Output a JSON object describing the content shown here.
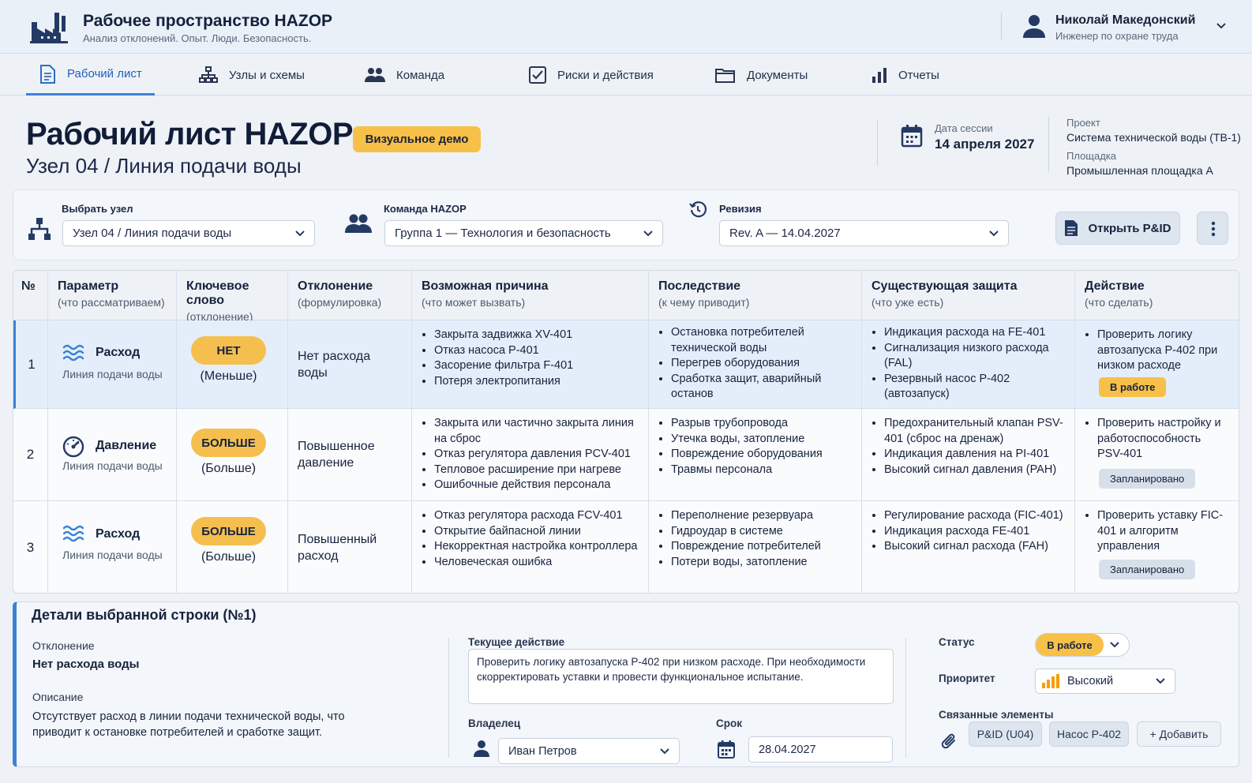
{
  "header": {
    "title": "Рабочее пространство HAZOP",
    "subtitle": "Анализ отклонений. Опыт. Люди. Безопасность.",
    "user_name": "Николай Македонский",
    "user_role": "Инженер по охране труда"
  },
  "nav": {
    "tabs": [
      {
        "label": "Рабочий лист",
        "icon": "document-icon",
        "active": true
      },
      {
        "label": "Узлы и схемы",
        "icon": "hierarchy-icon"
      },
      {
        "label": "Команда",
        "icon": "team-icon"
      },
      {
        "label": "Риски и действия",
        "icon": "checkbox-icon"
      },
      {
        "label": "Документы",
        "icon": "folder-icon"
      },
      {
        "label": "Отчеты",
        "icon": "bar-chart-icon"
      }
    ]
  },
  "page": {
    "title": "Рабочий лист HAZOP",
    "badge": "Визуальное демо",
    "subtitle": "Узел 04 / Линия подачи воды",
    "date_label": "Дата сессии",
    "date_value": "14 апреля 2027",
    "project_label": "Проект",
    "project_value": "Система технической воды (ТВ-1)",
    "site_label": "Площадка",
    "site_value": "Промышленная площадка А"
  },
  "filters": {
    "node_label": "Выбрать узел",
    "node_value": "Узел 04 / Линия подачи воды",
    "team_label": "Команда HAZOP",
    "team_value": "Группа 1 — Технология и безопасность",
    "rev_label": "Ревизия",
    "rev_value": "Rev. A — 14.04.2027",
    "pid_button": "Открыть P&ID"
  },
  "table": {
    "columns": [
      {
        "title": "№",
        "sub": ""
      },
      {
        "title": "Параметр",
        "sub": "(что рассматриваем)"
      },
      {
        "title": "Ключевое слово",
        "sub": "(отклонение)"
      },
      {
        "title": "Отклонение",
        "sub": "(формулировка)"
      },
      {
        "title": "Возможная причина",
        "sub": "(что может вызвать)"
      },
      {
        "title": "Последствие",
        "sub": "(к чему приводит)"
      },
      {
        "title": "Существующая защита",
        "sub": "(что уже есть)"
      },
      {
        "title": "Действие",
        "sub": "(что сделать)"
      }
    ],
    "rows": [
      {
        "num": "1",
        "param": "Расход",
        "param_sub": "Линия подачи воды",
        "param_icon": "waves-icon",
        "keyword": "НЕТ",
        "keyword_sub": "(Меньше)",
        "deviation": "Нет расхода воды",
        "causes": [
          "Закрыта задвижка XV-401",
          "Отказ насоса P-401",
          "Засорение фильтра F-401",
          "Потеря электропитания"
        ],
        "consequences": [
          "Остановка потребителей технической воды",
          "Перегрев оборудования",
          "Сработка защит, аварийный останов"
        ],
        "safeguards": [
          "Индикация расхода на FE-401",
          "Сигнализация низкого расхода (FAL)",
          "Резервный насос P-402 (автозапуск)"
        ],
        "action": "Проверить логику автозапуска P-402 при низком расходе",
        "status": "В работе"
      },
      {
        "num": "2",
        "param": "Давление",
        "param_sub": "Линия подачи воды",
        "param_icon": "gauge-icon",
        "keyword": "БОЛЬШЕ",
        "keyword_sub": "(Больше)",
        "deviation": "Повышенное давление",
        "causes": [
          "Закрыта или частично закрыта линия на сброс",
          "Отказ регулятора давления PCV-401",
          "Тепловое расширение при нагреве",
          "Ошибочные действия персонала"
        ],
        "consequences": [
          "Разрыв трубопровода",
          "Утечка воды, затопление",
          "Повреждение оборудования",
          "Травмы персонала"
        ],
        "safeguards": [
          "Предохранительный клапан PSV-401 (сброс на дренаж)",
          "Индикация давления на PI-401",
          "Высокий сигнал давления (PAH)"
        ],
        "action": "Проверить настройку и работоспособность PSV-401",
        "status": "Запланировано"
      },
      {
        "num": "3",
        "param": "Расход",
        "param_sub": "Линия подачи воды",
        "param_icon": "waves-icon",
        "keyword": "БОЛЬШЕ",
        "keyword_sub": "(Больше)",
        "deviation": "Повышенный расход",
        "causes": [
          "Отказ регулятора расхода FCV-401",
          "Открытие байпасной линии",
          "Некорректная настройка контроллера",
          "Человеческая ошибка"
        ],
        "consequences": [
          "Переполнение резервуара",
          "Гидроудар в системе",
          "Повреждение потребителей",
          "Потери воды, затопление"
        ],
        "safeguards": [
          "Регулирование расхода (FIC-401)",
          "Индикация расхода FE-401",
          "Высокий сигнал расхода (FAH)"
        ],
        "action": "Проверить уставку FIC-401 и алгоритм управления",
        "status": "Запланировано"
      }
    ]
  },
  "details": {
    "title": "Детали выбранной строки (№1)",
    "deviation_label": "Отклонение",
    "deviation_value": "Нет расхода воды",
    "description_label": "Описание",
    "description_value": "Отсутствует расход в линии подачи технической воды, что приводит к остановке потребителей и сработке защит.",
    "current_action_label": "Текущее действие",
    "current_action_value": "Проверить логику автозапуска P-402 при низком расходе. При необходимости скорректировать уставки и провести функциональное испытание.",
    "owner_label": "Владелец",
    "owner_value": "Иван Петров",
    "due_label": "Срок",
    "due_value": "28.04.2027",
    "status_label": "Статус",
    "status_value": "В работе",
    "priority_label": "Приоритет",
    "priority_value": "Высокий",
    "linked_label": "Связанные элементы",
    "linked": [
      "P&ID (U04)",
      "Насос P-402"
    ],
    "add_label": "+ Добавить"
  },
  "colors": {
    "accent": "#3b82d6",
    "badge": "#f7c048",
    "priority": "#f59e0b"
  }
}
